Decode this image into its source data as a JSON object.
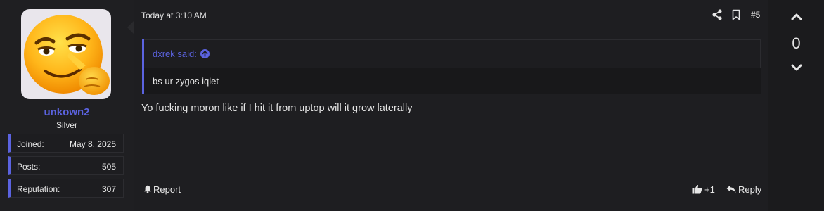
{
  "user": {
    "username": "unkown2",
    "rank": "Silver",
    "stats": [
      {
        "label": "Joined:",
        "value": "May 8, 2025"
      },
      {
        "label": "Posts:",
        "value": "505"
      },
      {
        "label": "Reputation:",
        "value": "307"
      }
    ],
    "avatar_icon": "smirking-emoji-avatar"
  },
  "post": {
    "timestamp": "Today at 3:10 AM",
    "number": "#5",
    "share_icon": "share-icon",
    "bookmark_icon": "bookmark-icon",
    "quote": {
      "author": "dxrek said:",
      "body": "bs ur zygos iqlet"
    },
    "body": "Yo fucking moron like if I hit it from uptop will it grow laterally",
    "actions": {
      "report": "Report",
      "reaction_count": "+1",
      "reply": "Reply"
    }
  },
  "vote": {
    "count": "0"
  },
  "colors": {
    "accent": "#5b63e0",
    "background": "#1b1b1d",
    "text": "#e6e6e6"
  }
}
